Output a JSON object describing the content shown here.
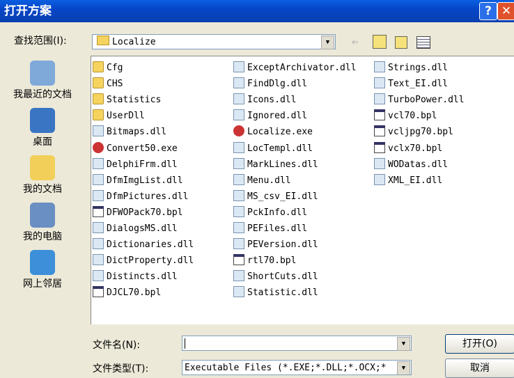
{
  "title": "打开方案",
  "lookin": {
    "label": "查找范围(I):",
    "value": "Localize"
  },
  "places": [
    {
      "label": "我最近的文档",
      "color": "#7fa9d9"
    },
    {
      "label": "桌面",
      "color": "#3a75c4"
    },
    {
      "label": "我的文档",
      "color": "#f2cf58"
    },
    {
      "label": "我的电脑",
      "color": "#6a8fc2"
    },
    {
      "label": "网上邻居",
      "color": "#3c8fd8"
    }
  ],
  "files": [
    {
      "name": "Cfg",
      "type": "folder"
    },
    {
      "name": "CHS",
      "type": "folder"
    },
    {
      "name": "Statistics",
      "type": "folder"
    },
    {
      "name": "UserDll",
      "type": "folder"
    },
    {
      "name": "Bitmaps.dll",
      "type": "dll"
    },
    {
      "name": "Convert50.exe",
      "type": "exe"
    },
    {
      "name": "DelphiFrm.dll",
      "type": "dll"
    },
    {
      "name": "DfmImgList.dll",
      "type": "dll"
    },
    {
      "name": "DfmPictures.dll",
      "type": "dll"
    },
    {
      "name": "DFWOPack70.bpl",
      "type": "bpl"
    },
    {
      "name": "DialogsMS.dll",
      "type": "dll"
    },
    {
      "name": "Dictionaries.dll",
      "type": "dll"
    },
    {
      "name": "DictProperty.dll",
      "type": "dll"
    },
    {
      "name": "Distincts.dll",
      "type": "dll"
    },
    {
      "name": "DJCL70.bpl",
      "type": "bpl"
    },
    {
      "name": "ExceptArchivator.dll",
      "type": "dll"
    },
    {
      "name": "FindDlg.dll",
      "type": "dll"
    },
    {
      "name": "Icons.dll",
      "type": "dll"
    },
    {
      "name": "Ignored.dll",
      "type": "dll"
    },
    {
      "name": "Localize.exe",
      "type": "exe"
    },
    {
      "name": "LocTempl.dll",
      "type": "dll"
    },
    {
      "name": "MarkLines.dll",
      "type": "dll"
    },
    {
      "name": "Menu.dll",
      "type": "dll"
    },
    {
      "name": "MS_csv_EI.dll",
      "type": "dll"
    },
    {
      "name": "PckInfo.dll",
      "type": "dll"
    },
    {
      "name": "PEFiles.dll",
      "type": "dll"
    },
    {
      "name": "PEVersion.dll",
      "type": "dll"
    },
    {
      "name": "rtl70.bpl",
      "type": "bpl"
    },
    {
      "name": "ShortCuts.dll",
      "type": "dll"
    },
    {
      "name": "Statistic.dll",
      "type": "dll"
    },
    {
      "name": "Strings.dll",
      "type": "dll"
    },
    {
      "name": "Text_EI.dll",
      "type": "dll"
    },
    {
      "name": "TurboPower.dll",
      "type": "dll"
    },
    {
      "name": "vcl70.bpl",
      "type": "bpl"
    },
    {
      "name": "vcljpg70.bpl",
      "type": "bpl"
    },
    {
      "name": "vclx70.bpl",
      "type": "bpl"
    },
    {
      "name": "WODatas.dll",
      "type": "dll"
    },
    {
      "name": "XML_EI.dll",
      "type": "dll"
    }
  ],
  "filename": {
    "label": "文件名(N):",
    "value": ""
  },
  "filetype": {
    "label": "文件类型(T):",
    "value": "Executable Files (*.EXE;*.DLL;*.OCX;*"
  },
  "buttons": {
    "open": "打开(O)",
    "cancel": "取消"
  }
}
